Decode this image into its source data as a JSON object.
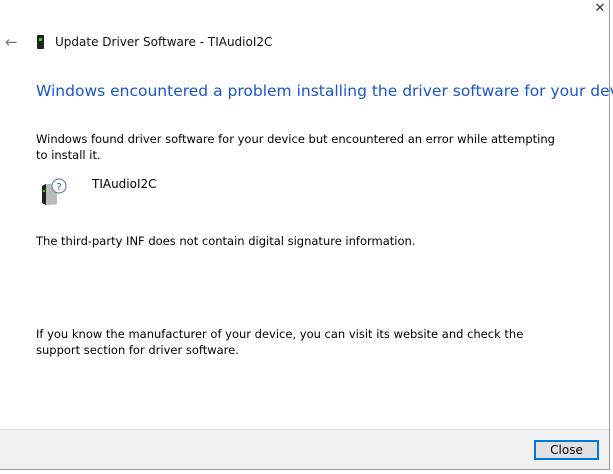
{
  "window": {
    "title": "Update Driver Software - TIAudioI2C",
    "close_glyph": "✕",
    "back_glyph": "←"
  },
  "main": {
    "heading": "Windows encountered a problem installing the driver software for your device",
    "intro": "Windows found driver software for your device but encountered an error while attempting to install it.",
    "device_name": "TIAudioI2C",
    "error": "The third-party INF does not contain digital signature information.",
    "help": "If you know the manufacturer of your device, you can visit its website and check the support section for driver software."
  },
  "footer": {
    "close_label": "Close"
  }
}
